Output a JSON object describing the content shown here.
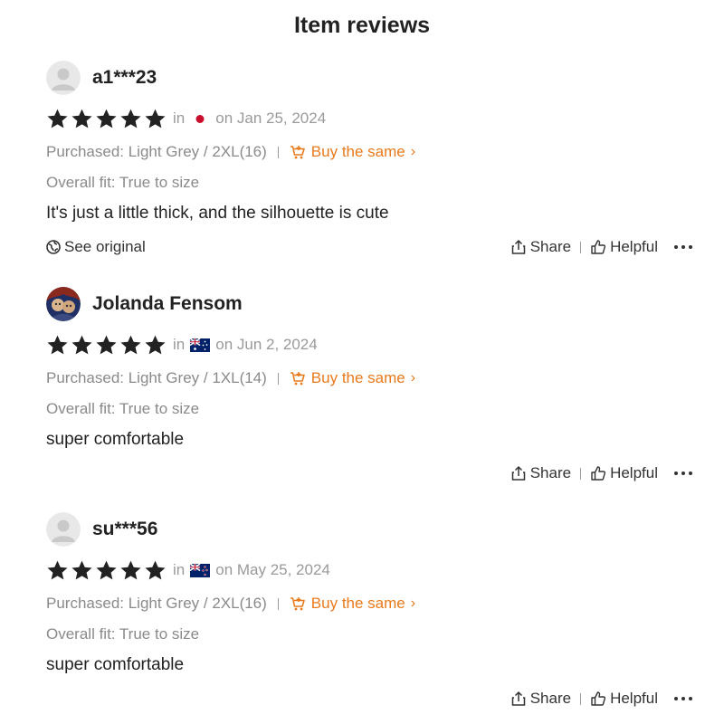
{
  "page": {
    "title": "Item reviews"
  },
  "reviews": [
    {
      "username": "a1***23",
      "avatar": "default-avatar",
      "stars": 5,
      "in_label": "in",
      "flag": "japan-flag",
      "date": "on Jan 25, 2024",
      "purchased": "Purchased: Light Grey / 2XL(16)",
      "buy_same": "Buy the same",
      "fit": "Overall fit: True to size",
      "comment": "It's just a little thick, and the silhouette is cute",
      "see_original": "See original",
      "share": "Share",
      "helpful": "Helpful"
    },
    {
      "username": "Jolanda Fensom",
      "avatar": "photo-avatar",
      "stars": 5,
      "in_label": "in",
      "flag": "australia-flag",
      "date": "on Jun 2, 2024",
      "purchased": "Purchased: Light Grey / 1XL(14)",
      "buy_same": "Buy the same",
      "fit": "Overall fit: True to size",
      "comment": "super comfortable",
      "see_original": "",
      "share": "Share",
      "helpful": "Helpful"
    },
    {
      "username": "su***56",
      "avatar": "default-avatar",
      "stars": 5,
      "in_label": "in",
      "flag": "new-zealand-flag",
      "date": "on May 25, 2024",
      "purchased": "Purchased: Light Grey / 2XL(16)",
      "buy_same": "Buy the same",
      "fit": "Overall fit: True to size",
      "comment": "super comfortable",
      "see_original": "",
      "share": "Share",
      "helpful": "Helpful"
    }
  ],
  "colors": {
    "accent": "#e97a1c",
    "star": "#222222",
    "muted": "#8a8a8a"
  }
}
